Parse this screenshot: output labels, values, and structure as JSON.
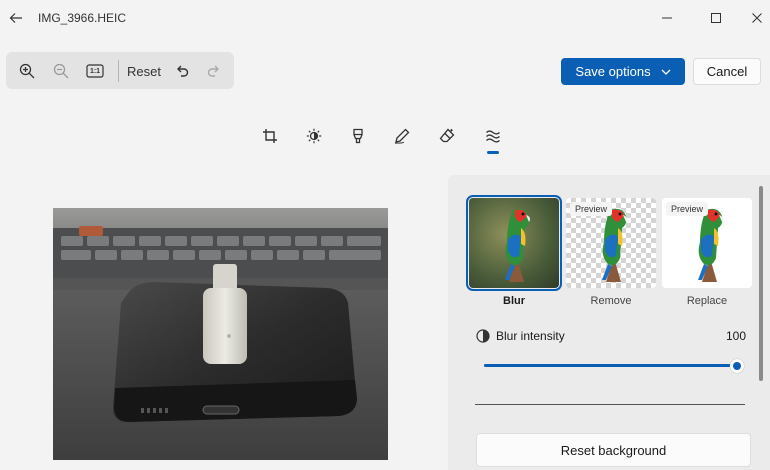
{
  "window": {
    "title": "IMG_3966.HEIC"
  },
  "toolbar": {
    "zoom_in": "zoom-in-icon",
    "zoom_out": "zoom-out-icon",
    "actual_size_label": "1:1",
    "reset_label": "Reset",
    "undo": "undo-icon",
    "redo": "redo-icon"
  },
  "actions": {
    "save_label": "Save options",
    "cancel_label": "Cancel"
  },
  "edit_tabs": [
    {
      "icon": "crop-icon"
    },
    {
      "icon": "brightness-icon"
    },
    {
      "icon": "marker-icon"
    },
    {
      "icon": "pen-icon"
    },
    {
      "icon": "erase-icon"
    },
    {
      "icon": "background-icon",
      "selected": true
    }
  ],
  "background_panel": {
    "options": [
      {
        "label": "Blur",
        "selected": true,
        "badge": ""
      },
      {
        "label": "Remove",
        "selected": false,
        "badge": "Preview"
      },
      {
        "label": "Replace",
        "selected": false,
        "badge": "Preview"
      }
    ],
    "intensity": {
      "label": "Blur intensity",
      "value": "100",
      "fraction": 1.0
    },
    "reset_label": "Reset background"
  },
  "colors": {
    "accent": "#0a5fb4",
    "background": "#f3f3f3",
    "panel": "#ebebeb"
  }
}
